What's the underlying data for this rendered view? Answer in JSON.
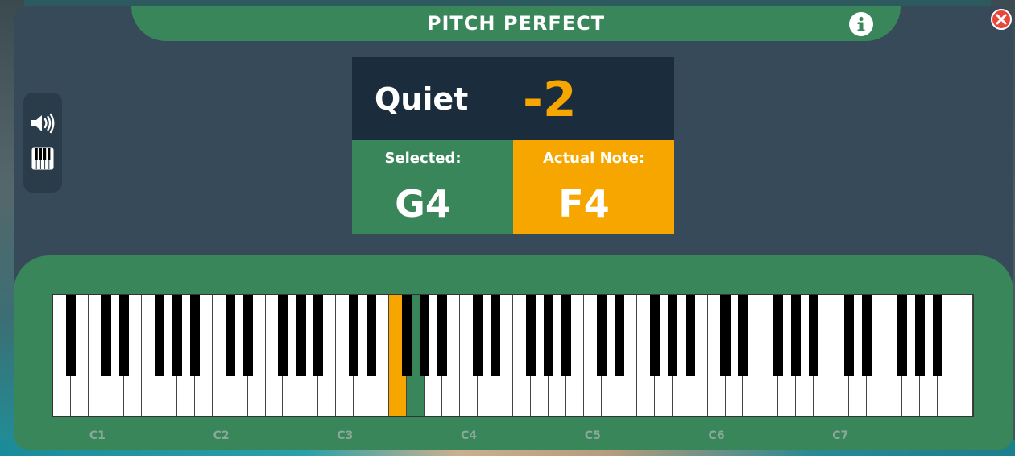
{
  "app": {
    "title": "PITCH PERFECT"
  },
  "icons": {
    "info": "info-icon",
    "close": "close-icon",
    "volume": "volume-icon",
    "piano": "piano-icon"
  },
  "score": {
    "rating": "Quiet",
    "offset": "-2"
  },
  "selected": {
    "label": "Selected:",
    "note": "G4"
  },
  "actual": {
    "label": "Actual Note:",
    "note": "F4"
  },
  "keyboard": {
    "octave_labels": [
      "C1",
      "C2",
      "C3",
      "C4",
      "C5",
      "C6",
      "C7"
    ],
    "highlighted_orange": "F3",
    "highlighted_green": "G3"
  },
  "colors": {
    "green": "#388659",
    "orange": "#f7a600",
    "panel": "#374a5a",
    "dark": "#1b2d3c",
    "close_red": "#e8463a"
  }
}
